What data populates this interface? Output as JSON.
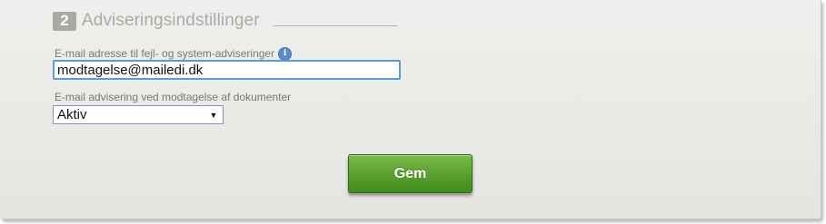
{
  "section": {
    "step_number": "2",
    "title": "Adviseringsindstillinger"
  },
  "email_field": {
    "label": "E-mail adresse til fejl- og system-adviseringer",
    "info_icon": "info-icon",
    "value": "modtagelse@mailedi.dk"
  },
  "advisering_field": {
    "label": "E-mail advisering ved modtagelse af dokumenter",
    "selected": "Aktiv",
    "arrow_glyph": "▼"
  },
  "buttons": {
    "save_label": "Gem"
  },
  "colors": {
    "input_focus_border": "#5d9ad8",
    "button_green": "#5fa332",
    "badge_gray": "#a8a8a5"
  }
}
